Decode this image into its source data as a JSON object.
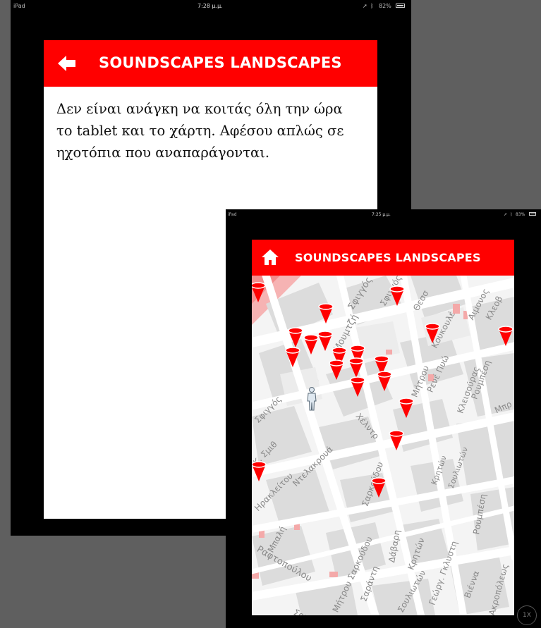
{
  "back_screen": {
    "status": {
      "device": "iPad",
      "time": "7:28 μ.μ.",
      "battery": "82%"
    },
    "header": {
      "title": "SOUNDSCAPES LANDSCAPES",
      "icon": "arrow-left-icon"
    },
    "body_text": "Δεν είναι ανάγκη να κοιτάς όλη την ώρα το tablet και το χάρτη. Αφέσου απλώς σε ηχοτόπια που αναπαράγονται."
  },
  "front_screen": {
    "status": {
      "device": "iPad",
      "time": "7:25 μ.μ.",
      "battery": "83%"
    },
    "header": {
      "title": "SOUNDSCAPES LANDSCAPES",
      "icon": "home-icon"
    },
    "map": {
      "streets": [
        "Σφιγγός",
        "Μουμτζή",
        "Σφιγγός",
        "Θεσσ",
        "Κουκουλέ",
        "Αιμονος",
        "Κλεοβ",
        "Ρενέ Πυώ",
        "Μήτρου",
        "Ρουμπέση",
        "Κλεισούρας",
        "Μπρ",
        "Σφιγγός",
        "Χέλντρ",
        "Κ. Σμιθ",
        "Ηρακλείτου",
        "Ντελακρουά",
        "Κρητών",
        "Σουλιωτών",
        "Μπαλή",
        "Σαρκούδου",
        "Δάβαρη",
        "Ραφτοπούλου",
        "Μήτρου Σαρκούδου",
        "Σαράντη",
        "Κρητών",
        "Σουλιωτών",
        "Γεώργ. Γκλυστη",
        "Βιέννα",
        "Ακροπόλεως",
        "Ρουμπέση",
        "Σουλ"
      ],
      "zoom_label": "1X"
    }
  }
}
